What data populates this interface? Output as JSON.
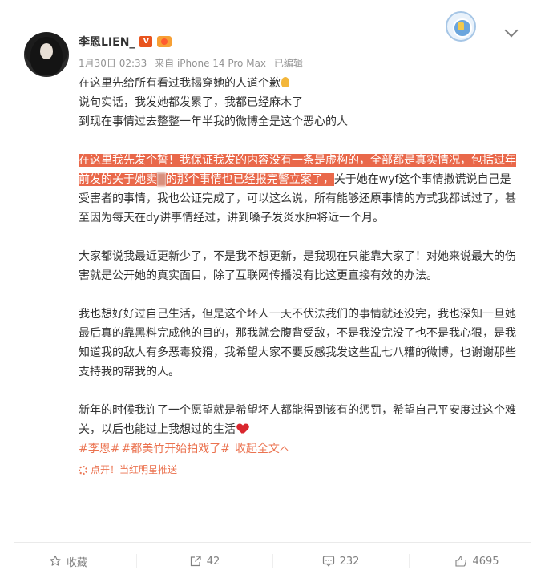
{
  "user": {
    "name": "李恩LIEN_",
    "vip_badge": "V",
    "timestamp": "1月30日 02:33",
    "source": "来自 iPhone 14 Pro Max",
    "edited": "已编辑"
  },
  "post": {
    "lines_p1": [
      "在这里先给所有看过我揭穿她的人道个歉",
      "说句实话，我发她都发累了，我都已经麻木了",
      "到现在事情过去整整一年半我的微博全是这个恶心的人"
    ],
    "p2_highlight_a": "在这里我先发个誓！我保证我发的内容没有一条是虚构的，全部都是真实情况，包括过年前发的关于她卖",
    "p2_redacted": "▒",
    "p2_highlight_b": "的那个事情也已经报完警立案了，",
    "p2_rest": "关于她在wyf这个事情撒谎说自己是受害者的事情，我也公证完成了，可以这么说，所有能够还原事情的方式我都试过了，甚至因为每天在dy讲事情经过，讲到嗓子发炎水肿将近一个月。",
    "p3": "大家都说我最近更新少了，不是我不想更新，是我现在只能靠大家了！对她来说最大的伤害就是公开她的真实面目，除了互联网传播没有比这更直接有效的办法。",
    "p4": "我也想好好过自己生活，但是这个坏人一天不伏法我们的事情就还没完，我也深知一旦她最后真的靠黑料完成他的目的，那我就会腹背受敌，不是我没完没了也不是我心狠，是我知道我的敌人有多恶毒狡猾，我希望大家不要反感我发这些乱七八糟的微博，也谢谢那些支持我的帮我的人。",
    "p5": "新年的时候我许了一个愿望就是希望坏人都能得到该有的惩罚，希望自己平安度过这个难关，以后也能过上我想过的生活",
    "topic_1": "#李恩#",
    "topic_2": "#都美竹开始拍戏了#",
    "collapse_label": "收起全文",
    "promo_text": "点开！当红明星推送"
  },
  "actions": {
    "favorite_label": "收藏",
    "repost_count": "42",
    "comment_count": "232",
    "like_count": "4695"
  },
  "colors": {
    "highlight_bg": "#e9684a",
    "link": "#eb7350",
    "meta_text": "#939393"
  },
  "icons": {
    "favorite": "star-outline-icon",
    "repost": "repost-icon",
    "comment": "comment-icon",
    "like": "thumbs-up-icon",
    "more": "chevron-down-icon",
    "club": "club-badge-icon"
  }
}
